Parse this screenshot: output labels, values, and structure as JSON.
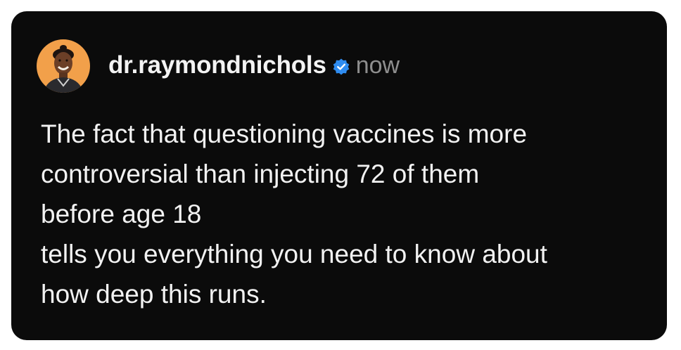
{
  "post": {
    "author": {
      "username": "dr.raymondnichols",
      "verified_icon": "verified-badge-icon",
      "avatar_icon": "avatar-photo"
    },
    "timestamp": "now",
    "lines": [
      "The fact that questioning vaccines is more",
      "controversial than injecting 72 of them",
      "before age 18",
      "tells you everything you need to know about",
      "how deep this runs."
    ]
  },
  "colors": {
    "page_background": "#ffffff",
    "card_background": "#0b0b0b",
    "text_primary": "#f2f2f2",
    "text_secondary": "#8e8e8e",
    "verified_blue": "#2f8cf0",
    "avatar_background": "#f2a04a"
  }
}
